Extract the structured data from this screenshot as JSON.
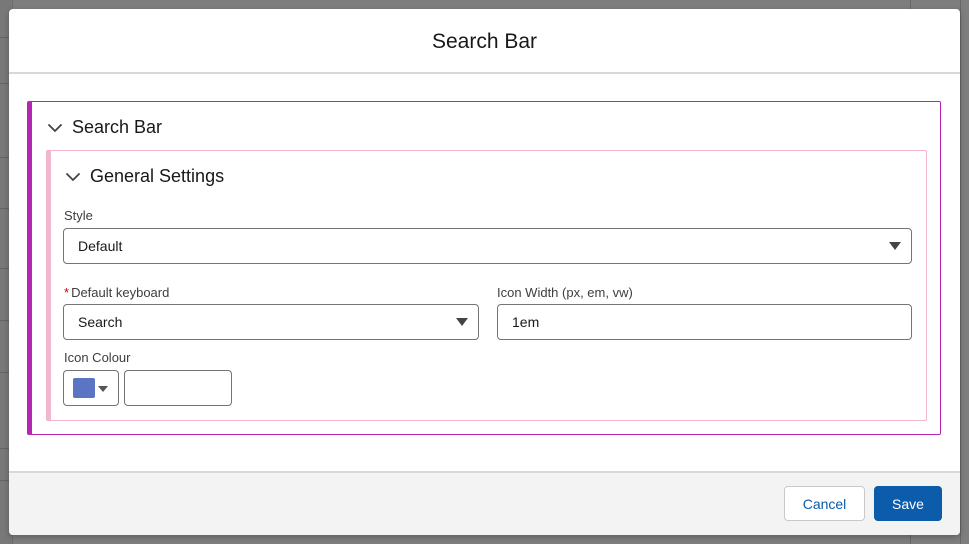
{
  "modal": {
    "title": "Search Bar"
  },
  "outer_section": {
    "label": "Search Bar",
    "expanded": true,
    "accent_color": "#b526b5"
  },
  "inner_section": {
    "label": "General Settings",
    "expanded": true,
    "accent_color": "#f3b5cf"
  },
  "fields": {
    "style": {
      "label": "Style",
      "value": "Default"
    },
    "default_keyboard": {
      "label": "Default keyboard",
      "required_marker": "*",
      "value": "Search"
    },
    "icon_width": {
      "label": "Icon Width (px, em, vw)",
      "value": "1em"
    },
    "icon_colour": {
      "label": "Icon Colour",
      "swatch_color": "#5b74c4",
      "value": ""
    }
  },
  "footer": {
    "cancel_label": "Cancel",
    "save_label": "Save",
    "primary_color": "#0b5cab"
  }
}
